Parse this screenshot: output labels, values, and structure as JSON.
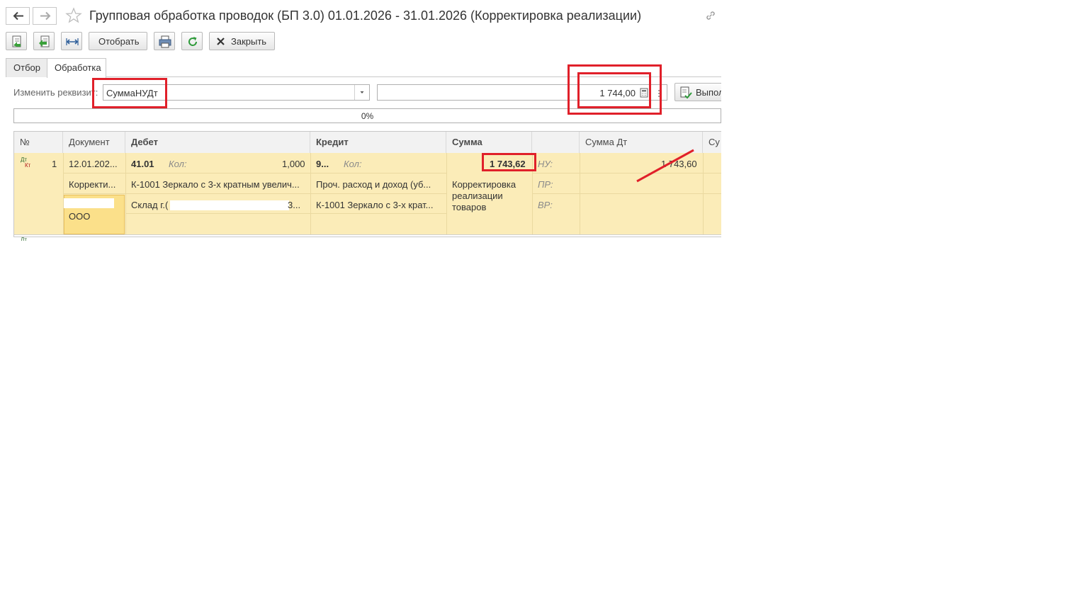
{
  "window": {
    "title": "Групповая обработка проводок (БП 3.0) 01.01.2026 - 31.01.2026 (Корректировка реализации)"
  },
  "toolbar": {
    "select_label": "Отобрать",
    "close_label": "Закрыть"
  },
  "tabs": [
    {
      "label": "Отбор",
      "active": false
    },
    {
      "label": "Обработка",
      "active": true
    }
  ],
  "form": {
    "change_attr_label": "Изменить реквизит:",
    "attr_value": "СуммаНУДт",
    "amount_value": "1 744,00",
    "execute_label": "Выпол"
  },
  "progress": {
    "text": "0%"
  },
  "table": {
    "headers": [
      "№",
      "Документ",
      "Дебет",
      "Кредит",
      "Сумма",
      "",
      "Сумма Дт",
      "Су"
    ],
    "row": {
      "icon_dt": "Дт",
      "icon_kt": "Кт",
      "number": "1",
      "doc_date": "12.01.202...",
      "doc_type": "Корректи...",
      "doc_org": "ООО",
      "debit_account": "41.01",
      "debit_qty_label": "Кол:",
      "debit_qty": "1,000",
      "debit_subconto1": "К-1001 Зеркало с 3-х кратным увелич...",
      "debit_subconto2_prefix": "Склад г.(",
      "debit_subconto2_suffix": "3...",
      "credit_account": "9...",
      "credit_qty_label": "Кол:",
      "credit_subconto1": "Проч. расход и доход  (уб...",
      "credit_subconto2": "К-1001 Зеркало с 3-х крат...",
      "sum": "1 743,62",
      "content": "Корректировка реализации товаров",
      "nu_label": "НУ:",
      "pr_label": "ПР:",
      "vr_label": "ВР:",
      "sum_dt_nu": "1 743,60"
    }
  },
  "colors": {
    "highlight_row": "#fbecb8",
    "annotation_red": "#e0202a"
  }
}
